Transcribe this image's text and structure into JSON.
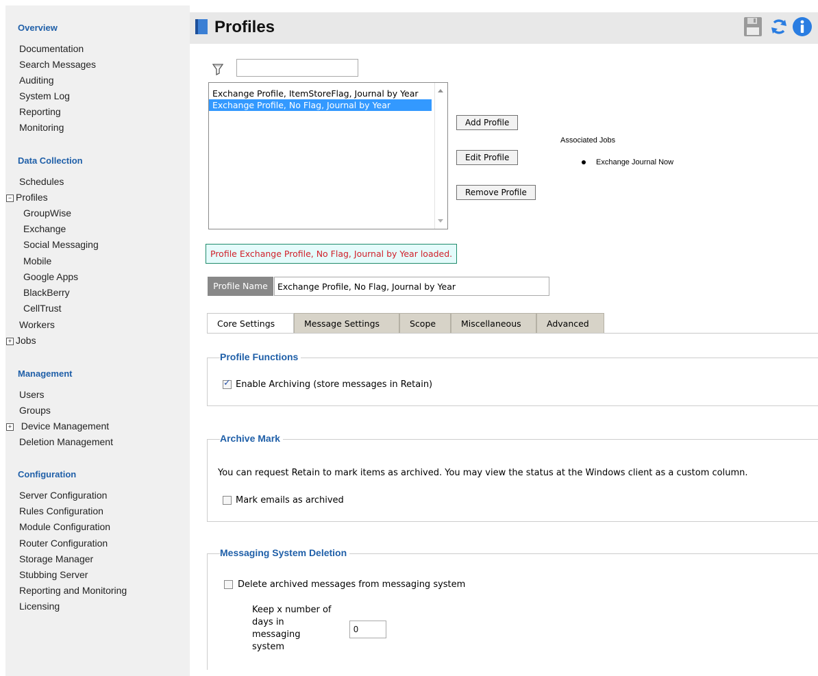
{
  "sidebar": {
    "overview": "Overview",
    "overview_items": [
      "Documentation",
      "Search Messages",
      "Auditing",
      "System Log",
      "Reporting",
      "Monitoring"
    ],
    "data_collection": "Data Collection",
    "schedules": "Schedules",
    "profiles": "Profiles",
    "profile_items": [
      "GroupWise",
      "Exchange",
      "Social Messaging",
      "Mobile",
      "Google Apps",
      "BlackBerry",
      "CellTrust"
    ],
    "workers": "Workers",
    "jobs": "Jobs",
    "management": "Management",
    "users": "Users",
    "groups": "Groups",
    "device_management": "Device Management",
    "deletion_management": "Deletion Management",
    "configuration": "Configuration",
    "config_items": [
      "Server Configuration",
      "Rules Configuration",
      "Module Configuration",
      "Router Configuration",
      "Storage Manager",
      "Stubbing Server",
      "Reporting and Monitoring",
      "Licensing"
    ]
  },
  "header": {
    "title": "Profiles"
  },
  "filter": {
    "value": ""
  },
  "profile_list": [
    "Exchange Profile, ItemStoreFlag, Journal by Year",
    "Exchange Profile, No Flag, Journal by Year"
  ],
  "buttons": {
    "add": "Add Profile",
    "edit": "Edit Profile",
    "remove": "Remove Profile"
  },
  "associated_jobs": {
    "label": "Associated Jobs",
    "items": [
      "Exchange Journal Now"
    ]
  },
  "status_message": "Profile Exchange Profile, No Flag, Journal by Year loaded.",
  "profile_name": {
    "label": "Profile Name",
    "value": "Exchange Profile, No Flag, Journal by Year"
  },
  "tabs": [
    "Core Settings",
    "Message Settings",
    "Scope",
    "Miscellaneous",
    "Advanced"
  ],
  "sections": {
    "profile_functions": {
      "title": "Profile Functions",
      "enable_archiving": "Enable Archiving (store messages in Retain)",
      "enable_archiving_checked": true
    },
    "archive_mark": {
      "title": "Archive Mark",
      "description": "You can request Retain to mark items as archived. You may view the status at the Windows client as a custom column.",
      "mark_label": "Mark emails as archived",
      "mark_checked": false
    },
    "messaging_deletion": {
      "title": "Messaging System Deletion",
      "delete_label": "Delete archived messages from messaging system",
      "delete_checked": false,
      "keep_label": "Keep x number of days in messaging system",
      "keep_value": "0"
    }
  },
  "colors": {
    "accent": "#1f5fa8",
    "selection": "#3399ff",
    "status_text": "#d0202a",
    "status_bg": "#e4fbfb"
  }
}
